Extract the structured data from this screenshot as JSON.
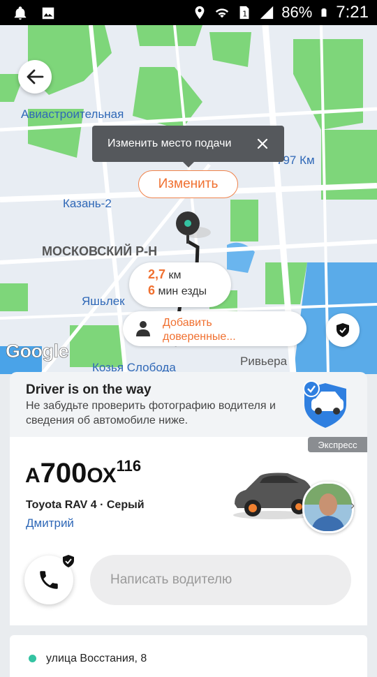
{
  "status_bar": {
    "battery": "86%",
    "time": "7:21",
    "icons": [
      "notification-bell-icon",
      "image-icon",
      "location-icon",
      "wifi-icon",
      "sim-icon",
      "signal-icon",
      "battery-icon"
    ]
  },
  "map": {
    "labels": {
      "aviastroitelnaya": "Авиастроительная",
      "km797": "797 Км",
      "kazan2": "Казань-2",
      "district": "МОСКОВСКИЙ Р-Н",
      "yashlek": "Яшьлек",
      "kozya": "Козья Слобода",
      "riviera": "Ривьера"
    },
    "tooltip": "Изменить место подачи",
    "change_button": "Изменить",
    "eta": {
      "distance_value": "2,7",
      "distance_unit": "км",
      "time_value": "6",
      "time_unit": "мин езды"
    },
    "trusted": {
      "line1": "Добавить",
      "line2": "доверенные..."
    },
    "attribution": "Google"
  },
  "sheet": {
    "title": "Driver is on the way",
    "subtitle": "Не забудьте проверить фотографию водителя и сведения об автомобиле ниже."
  },
  "driver_card": {
    "tariff": "Экспресс",
    "plate": {
      "letter": "А",
      "digits": "700",
      "letters2": "ОХ",
      "region": "116"
    },
    "car": "Toyota RAV 4 · Серый",
    "driver": "Дмитрий",
    "message_placeholder": "Написать водителю"
  },
  "address": "улица Восстания, 8",
  "colors": {
    "accent": "#f07030",
    "link": "#2f68b7",
    "park": "#7ed67a",
    "water": "#4aa3e8",
    "road": "#ffffff"
  }
}
